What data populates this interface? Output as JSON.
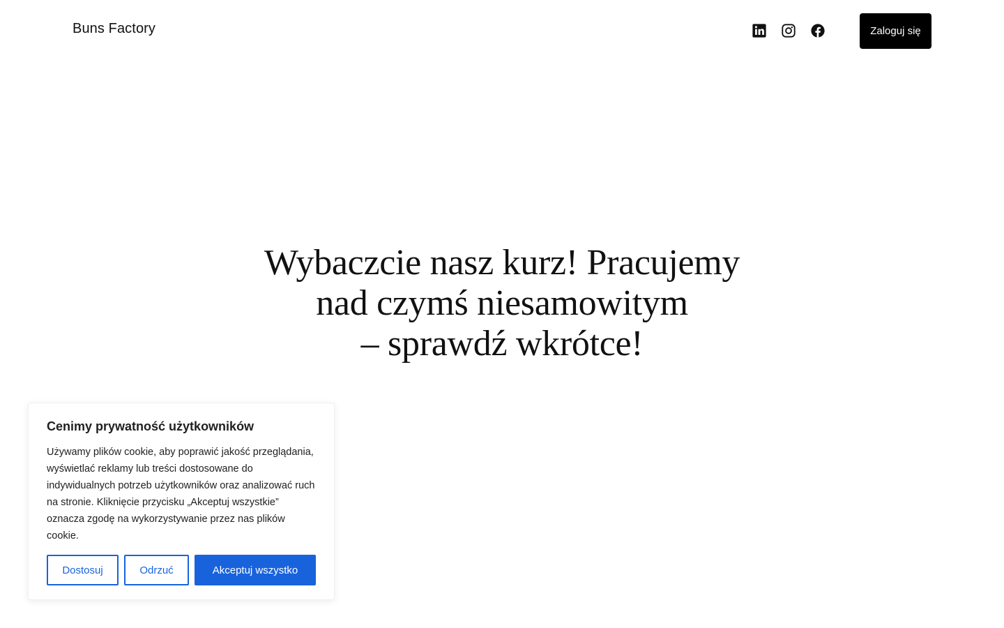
{
  "header": {
    "site_title": "Buns Factory",
    "social": {
      "linkedin": "linkedin-icon",
      "instagram": "instagram-icon",
      "facebook": "facebook-icon"
    },
    "login_label": "Zaloguj się"
  },
  "hero": {
    "line1": "Wybaczcie nasz kurz! Pracujemy",
    "line2": "nad czymś niesamowitym",
    "line3": "– sprawdź wkrótce!"
  },
  "cookie_banner": {
    "title": "Cenimy prywatność użytkowników",
    "text": "Używamy plików cookie, aby poprawić jakość przeglądania, wyświetlać reklamy lub treści dostosowane do indywidualnych potrzeb użytkowników oraz analizować ruch na stronie. Kliknięcie przycisku „Akceptuj wszystkie” oznacza zgodę na wykorzystywanie przez nas plików cookie.",
    "customize_label": "Dostosuj",
    "reject_label": "Odrzuć",
    "accept_label": "Akceptuj wszystko",
    "accent_color": "#1863dc"
  }
}
